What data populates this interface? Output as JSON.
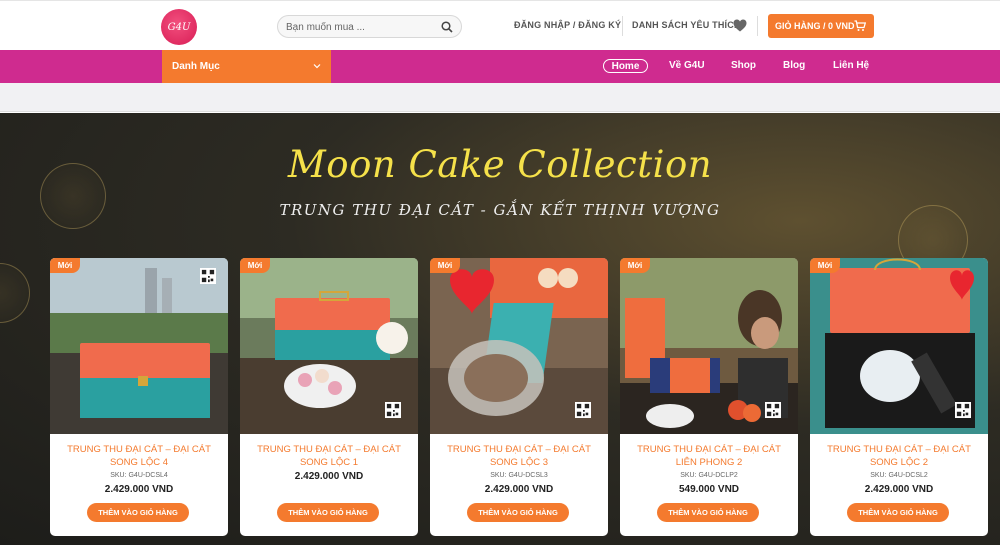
{
  "header": {
    "logo_text": "G4U",
    "search_placeholder": "Bạn muốn mua ...",
    "login_label": "ĐĂNG NHẬP / ĐĂNG KÝ",
    "wishlist_label": "DANH SÁCH YÊU THÍCH",
    "cart_label": "GIỎ HÀNG / 0 VND",
    "accent_color": "#f47a2e"
  },
  "nav": {
    "category_label": "Danh Mục",
    "items": [
      {
        "label": "Home",
        "active": true
      },
      {
        "label": "Về G4U"
      },
      {
        "label": "Shop"
      },
      {
        "label": "Blog"
      },
      {
        "label": "Liên Hệ"
      }
    ],
    "bar_color": "#cf2b8f"
  },
  "hero": {
    "title": "Moon Cake Collection",
    "subtitle": "TRUNG THU ĐẠI CÁT - GẮN KẾT THỊNH VƯỢNG",
    "title_color": "#f5e14a"
  },
  "products": [
    {
      "badge": "Mới",
      "title": "TRUNG THU ĐẠI CÁT – ĐẠI CÁT SONG LỘC 4",
      "sku": "SKU: G4U-DCSL4",
      "price": "2.429.000 VND",
      "button": "THÊM VÀO GIỎ HÀNG"
    },
    {
      "badge": "Mới",
      "title": "TRUNG THU ĐẠI CÁT – ĐẠI CÁT SONG LỘC 1",
      "sku": "",
      "price": "2.429.000 VND",
      "button": "THÊM VÀO GIỎ HÀNG"
    },
    {
      "badge": "Mới",
      "title": "TRUNG THU ĐẠI CÁT – ĐẠI CÁT SONG LỘC 3",
      "sku": "SKU: G4U-DCSL3",
      "price": "2.429.000 VND",
      "button": "THÊM VÀO GIỎ HÀNG"
    },
    {
      "badge": "Mới",
      "title": "TRUNG THU ĐẠI CÁT – ĐẠI CÁT LIÊN PHONG 2",
      "sku": "SKU: G4U-DCLP2",
      "price": "549.000 VND",
      "button": "THÊM VÀO GIỎ HÀNG"
    },
    {
      "badge": "Mới",
      "title": "TRUNG THU ĐẠI CÁT – ĐẠI CÁT SONG LỘC 2",
      "sku": "SKU: G4U-DCSL2",
      "price": "2.429.000 VND",
      "button": "THÊM VÀO GIỎ HÀNG"
    }
  ]
}
